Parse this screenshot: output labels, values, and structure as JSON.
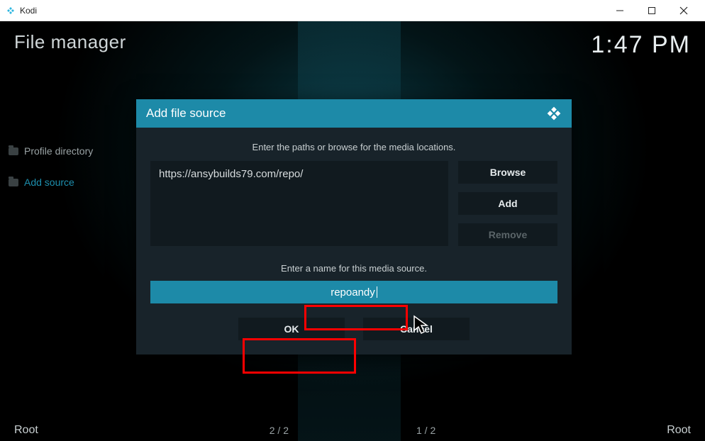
{
  "window": {
    "app_name": "Kodi"
  },
  "header": {
    "title": "File manager",
    "clock": "1:47 PM"
  },
  "sidebar": {
    "items": [
      {
        "label": "Profile directory",
        "active": false
      },
      {
        "label": "Add source",
        "active": true
      }
    ]
  },
  "footer": {
    "left_label": "Root",
    "right_label": "Root",
    "left_count": "2 / 2",
    "right_count": "1 / 2"
  },
  "dialog": {
    "title": "Add file source",
    "instruction_paths": "Enter the paths or browse for the media locations.",
    "path_value": "https://ansybuilds79.com/repo/",
    "buttons": {
      "browse": "Browse",
      "add": "Add",
      "remove": "Remove"
    },
    "instruction_name": "Enter a name for this media source.",
    "name_value": "repoandy",
    "ok_label": "OK",
    "cancel_label": "Cancel"
  }
}
